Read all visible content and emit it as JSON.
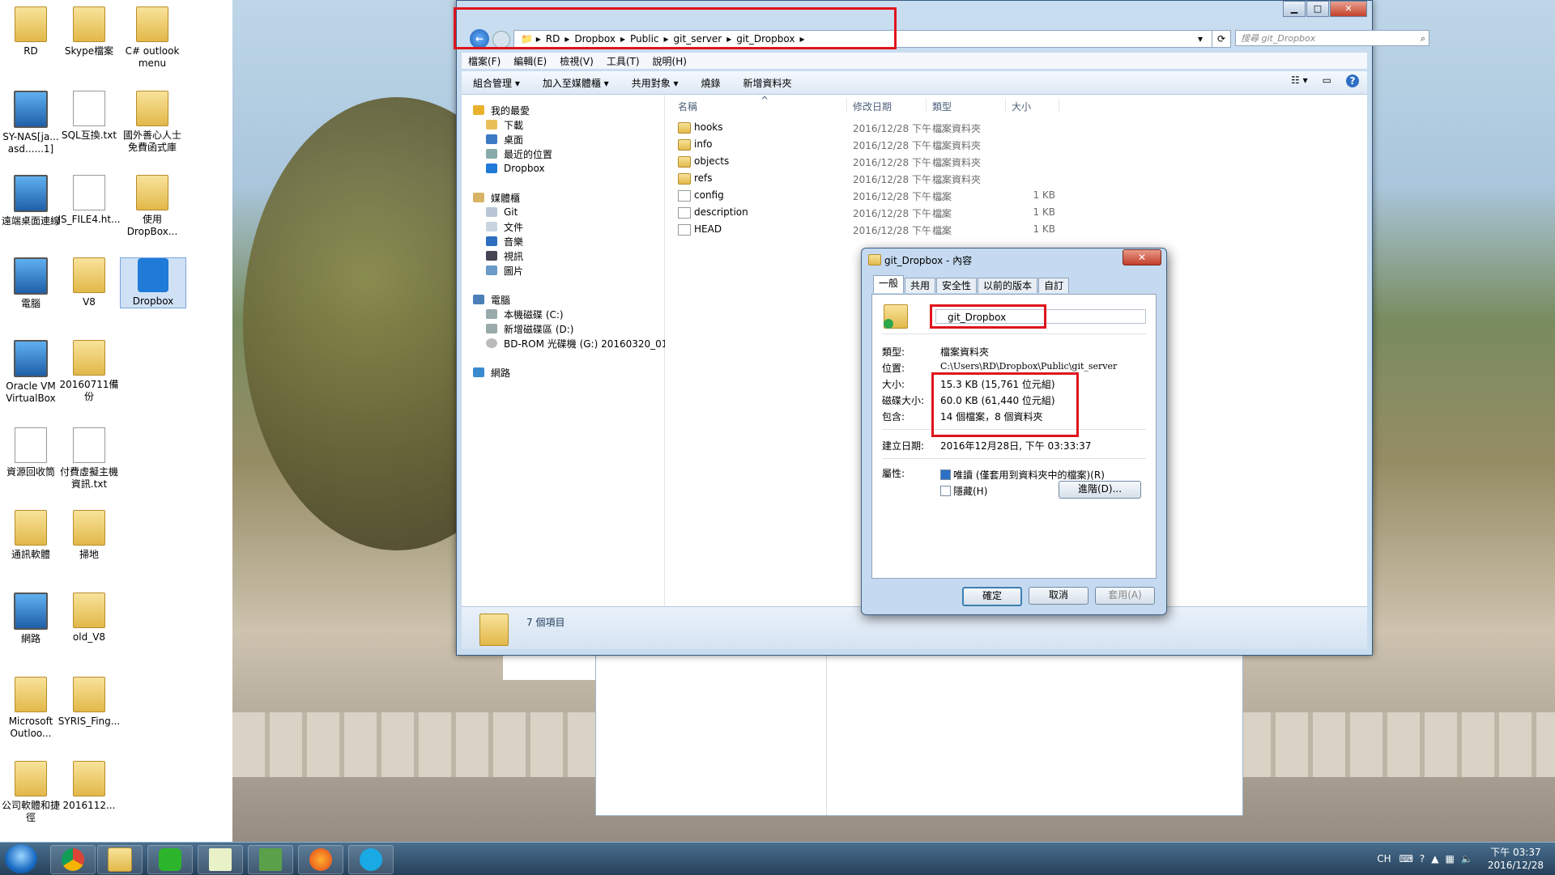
{
  "desktop": {
    "icons": [
      {
        "label": "RD",
        "kind": "folder"
      },
      {
        "label": "Skype檔案",
        "kind": "folder"
      },
      {
        "label": "C# outlook menu",
        "kind": "folder"
      },
      {
        "label": "SY-NAS[ja... asd......1]",
        "kind": "pc"
      },
      {
        "label": "SQL互換.txt",
        "kind": "file"
      },
      {
        "label": "國外善心人士免費函式庫",
        "kind": "folder"
      },
      {
        "label": "遠端桌面連線",
        "kind": "pc"
      },
      {
        "label": "JS_FILE4.ht...",
        "kind": "file"
      },
      {
        "label": "使用 DropBox...",
        "kind": "folder"
      },
      {
        "label": "電腦",
        "kind": "pc"
      },
      {
        "label": "V8",
        "kind": "folder"
      },
      {
        "label": "Dropbox",
        "kind": "dropbox"
      },
      {
        "label": "Oracle VM VirtualBox",
        "kind": "pc"
      },
      {
        "label": "20160711備份",
        "kind": "folder"
      },
      {
        "label": "資源回收筒",
        "kind": "file"
      },
      {
        "label": "付費虛擬主機資訊.txt",
        "kind": "file"
      },
      {
        "label": "通訊軟體",
        "kind": "folder"
      },
      {
        "label": "掃地",
        "kind": "folder"
      },
      {
        "label": "網路",
        "kind": "pc"
      },
      {
        "label": "old_V8",
        "kind": "folder"
      },
      {
        "label": "Microsoft Outloo...",
        "kind": "folder"
      },
      {
        "label": "SYRIS_Fing...",
        "kind": "folder"
      },
      {
        "label": "公司軟體和捷徑",
        "kind": "folder"
      },
      {
        "label": "2016112...",
        "kind": "folder"
      }
    ]
  },
  "explorer": {
    "breadcrumb": [
      "RD",
      "Dropbox",
      "Public",
      "git_server",
      "git_Dropbox"
    ],
    "search_placeholder": "搜尋 git_Dropbox",
    "menu": [
      "檔案(F)",
      "編輯(E)",
      "檢視(V)",
      "工具(T)",
      "說明(H)"
    ],
    "toolbar": [
      "組合管理 ▾",
      "加入至媒體櫃 ▾",
      "共用對象 ▾",
      "燒錄",
      "新增資料夾"
    ],
    "nav": {
      "favorites": "我的最愛",
      "fav_items": [
        "下載",
        "桌面",
        "最近的位置",
        "Dropbox"
      ],
      "libraries": "媒體櫃",
      "lib_items": [
        "Git",
        "文件",
        "音樂",
        "視訊",
        "圖片"
      ],
      "computer": "電腦",
      "comp_items": [
        "本機磁碟 (C:)",
        "新增磁碟區 (D:)",
        "BD-ROM 光碟機 (G:) 20160320_01"
      ],
      "network": "網路"
    },
    "columns": [
      "名稱",
      "修改日期",
      "類型",
      "大小"
    ],
    "files": [
      {
        "name": "hooks",
        "date": "2016/12/28 下午 ...",
        "type": "檔案資料夾",
        "size": "",
        "folder": true
      },
      {
        "name": "info",
        "date": "2016/12/28 下午 ...",
        "type": "檔案資料夾",
        "size": "",
        "folder": true
      },
      {
        "name": "objects",
        "date": "2016/12/28 下午 ...",
        "type": "檔案資料夾",
        "size": "",
        "folder": true
      },
      {
        "name": "refs",
        "date": "2016/12/28 下午 ...",
        "type": "檔案資料夾",
        "size": "",
        "folder": true
      },
      {
        "name": "config",
        "date": "2016/12/28 下午 ...",
        "type": "檔案",
        "size": "1 KB",
        "folder": false
      },
      {
        "name": "description",
        "date": "2016/12/28 下午 ...",
        "type": "檔案",
        "size": "1 KB",
        "folder": false
      },
      {
        "name": "HEAD",
        "date": "2016/12/28 下午 ...",
        "type": "檔案",
        "size": "1 KB",
        "folder": false
      }
    ],
    "status": "7 個項目"
  },
  "props": {
    "title": "git_Dropbox - 內容",
    "close": "✕",
    "tabs": [
      "一般",
      "共用",
      "安全性",
      "以前的版本",
      "自訂"
    ],
    "name": "git_Dropbox",
    "type_label": "類型:",
    "type_value": "檔案資料夾",
    "location_label": "位置:",
    "location_value": "C:\\Users\\RD\\Dropbox\\Public\\git_server",
    "size_label": "大小:",
    "size_value": "15.3 KB (15,761 位元組)",
    "disk_label": "磁碟大小:",
    "disk_value": "60.0 KB (61,440 位元組)",
    "contains_label": "包含:",
    "contains_value": "14 個檔案，8 個資料夾",
    "created_label": "建立日期:",
    "created_value": "2016年12月28日, 下午 03:33:37",
    "attr_label": "屬性:",
    "readonly": "唯讀 (僅套用到資料夾中的檔案)(R)",
    "hidden": "隱藏(H)",
    "advanced": "進階(D)...",
    "ok": "確定",
    "cancel": "取消",
    "apply": "套用(A)"
  },
  "taskbar": {
    "tray_lang": "CH",
    "time": "下午 03:37",
    "date": "2016/12/28"
  }
}
